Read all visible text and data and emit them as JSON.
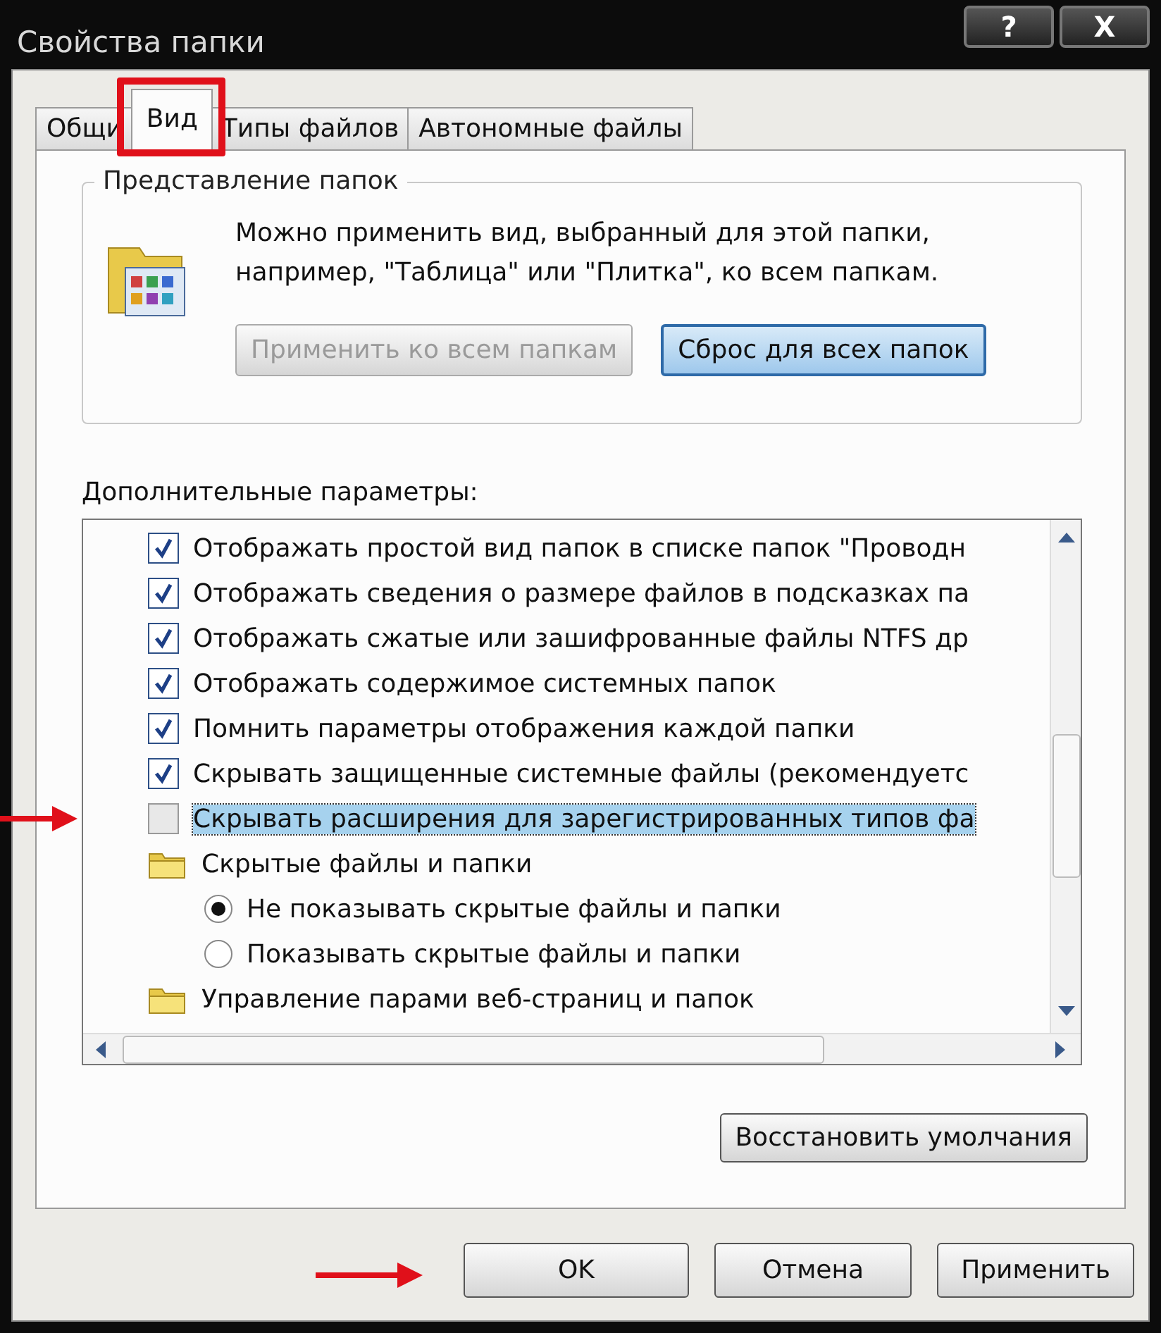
{
  "window": {
    "title": "Свойства папки",
    "help": "?",
    "close": "X"
  },
  "tabs": [
    {
      "label": "Общи",
      "selected": false,
      "highlighted": false
    },
    {
      "label": "Вид",
      "selected": true,
      "highlighted": true
    },
    {
      "label": "Типы файлов",
      "selected": false,
      "highlighted": false
    },
    {
      "label": "Автономные файлы",
      "selected": false,
      "highlighted": false
    }
  ],
  "folder_views": {
    "title": "Представление папок",
    "text": "Можно применить вид, выбранный для этой папки, например, \"Таблица\" или \"Плитка\", ко всем папкам.",
    "buttons": [
      {
        "label": "Применить ко всем папкам",
        "disabled": true,
        "focused": false
      },
      {
        "label": "Сброс для всех папок",
        "disabled": false,
        "focused": true
      }
    ]
  },
  "advanced": {
    "label": "Дополнительные параметры:",
    "items": [
      {
        "kind": "checkbox",
        "label": "Отображать простой вид папок в списке папок \"Проводн",
        "checked": true,
        "selected": false,
        "arrow": false
      },
      {
        "kind": "checkbox",
        "label": "Отображать сведения о размере файлов в подсказках па",
        "checked": true,
        "selected": false,
        "arrow": false
      },
      {
        "kind": "checkbox",
        "label": "Отображать сжатые или зашифрованные файлы NTFS др",
        "checked": true,
        "selected": false,
        "arrow": false
      },
      {
        "kind": "checkbox",
        "label": "Отображать содержимое системных папок",
        "checked": true,
        "selected": false,
        "arrow": false
      },
      {
        "kind": "checkbox",
        "label": "Помнить параметры отображения каждой папки",
        "checked": true,
        "selected": false,
        "arrow": false
      },
      {
        "kind": "checkbox",
        "label": "Скрывать защищенные системные файлы (рекомендуетс",
        "checked": true,
        "selected": false,
        "arrow": false
      },
      {
        "kind": "checkbox",
        "label": "Скрывать расширения для зарегистрированных типов фа",
        "checked": false,
        "selected": true,
        "arrow": true
      },
      {
        "kind": "folder",
        "label": "Скрытые файлы и папки",
        "children": [
          {
            "kind": "radio",
            "label": "Не показывать скрытые файлы и папки",
            "selected": true
          },
          {
            "kind": "radio",
            "label": "Показывать скрытые файлы и папки",
            "selected": false
          }
        ]
      },
      {
        "kind": "folder",
        "label": "Управление парами веб-страниц и папок"
      }
    ]
  },
  "restore_button": "Восстановить умолчания",
  "buttons": [
    {
      "label": "OK",
      "arrow": true
    },
    {
      "label": "Отмена",
      "arrow": false
    },
    {
      "label": "Применить",
      "arrow": false
    }
  ]
}
